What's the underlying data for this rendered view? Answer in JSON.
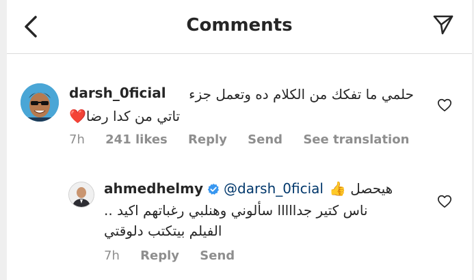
{
  "header": {
    "title": "Comments"
  },
  "comments": [
    {
      "username": "darsh_0ficial",
      "text_line1": "حلمي ما تفكك من الكلام ده وتعمل جزء",
      "text_line2": "تاتي من  كدا رضا❤️",
      "time": "7h",
      "likes": "241 likes",
      "reply_label": "Reply",
      "send_label": "Send",
      "translate_label": "See translation"
    }
  ],
  "reply": {
    "username": "ahmedhelmy",
    "mention": "@darsh_0ficial",
    "text_head": "هيحصل 👍",
    "text_line1": "ناس كتير جدااااا سألوني وهنلبي رغباتهم اكيد ..",
    "text_line2": "الفيلم بيتكتب دلوقتي",
    "time": "7h",
    "reply_label": "Reply",
    "send_label": "Send"
  },
  "colors": {
    "text": "#262626",
    "secondary": "#8e8e8e",
    "mention": "#00376b",
    "verified": "#3897f0"
  },
  "icons": [
    "back-arrow-icon",
    "send-icon",
    "heart-icon",
    "verified-badge-icon"
  ]
}
